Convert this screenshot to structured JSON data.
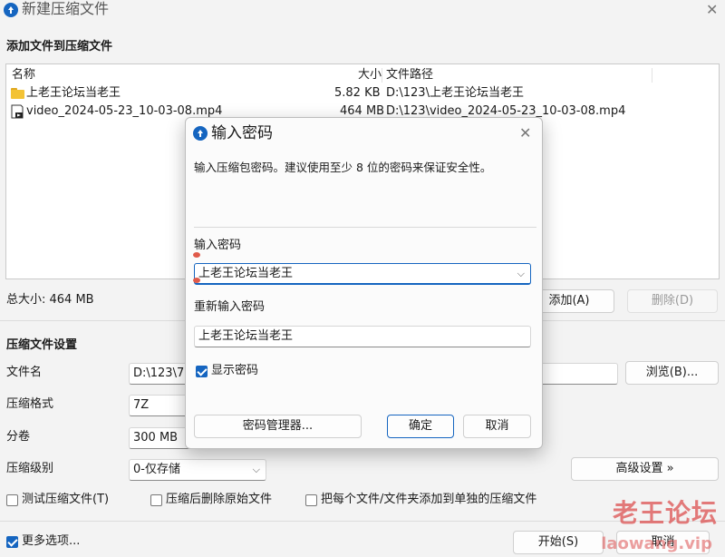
{
  "window": {
    "title": "新建压缩文件",
    "close_icon": "close-icon"
  },
  "add_section": {
    "title": "添加文件到压缩文件"
  },
  "file_list": {
    "columns": [
      "名称",
      "大小",
      "文件路径"
    ],
    "rows": [
      {
        "name": "上老王论坛当老王",
        "size": "5.82 KB",
        "path": "D:\\123\\上老王论坛当老王",
        "icon": "folder-icon"
      },
      {
        "name": "video_2024-05-23_10-03-08.mp4",
        "size": "464 MB",
        "path": "D:\\123\\video_2024-05-23_10-03-08.mp4",
        "icon": "video-file-icon"
      }
    ]
  },
  "total_size": "总大小: 464 MB",
  "list_buttons": {
    "add": "添加(A)",
    "delete": "删除(D)"
  },
  "settings": {
    "title": "压缩文件设置",
    "filename_label": "文件名",
    "filename_value": "D:\\123\\77",
    "browse": "浏览(B)...",
    "format_label": "压缩格式",
    "format_value": "7Z",
    "volume_label": "分卷",
    "volume_value": "300 MB",
    "level_label": "压缩级别",
    "level_value": "0-仅存储",
    "advanced": "高级设置 »",
    "test_archive": "测试压缩文件(T)",
    "delete_after": "压缩后删除原始文件",
    "separate_archives": "把每个文件/文件夹添加到单独的压缩文件"
  },
  "footer": {
    "more_options": "更多选项...",
    "start": "开始(S)",
    "cancel": "取消"
  },
  "dialog": {
    "title": "输入密码",
    "description": "输入压缩包密码。建议使用至少 8 位的密码来保证安全性。",
    "password_label": "输入密码",
    "password_value": "上老王论坛当老王",
    "reenter_label": "重新输入密码",
    "reenter_value": "上老王论坛当老王",
    "show_password": "显示密码",
    "manager_button": "密码管理器...",
    "ok_button": "确定",
    "cancel_button": "取消"
  },
  "watermark": {
    "line1": "老王论坛",
    "line2": "laowang.vip"
  },
  "colors": {
    "accent": "#1565c0",
    "watermark": "#dc5050"
  }
}
